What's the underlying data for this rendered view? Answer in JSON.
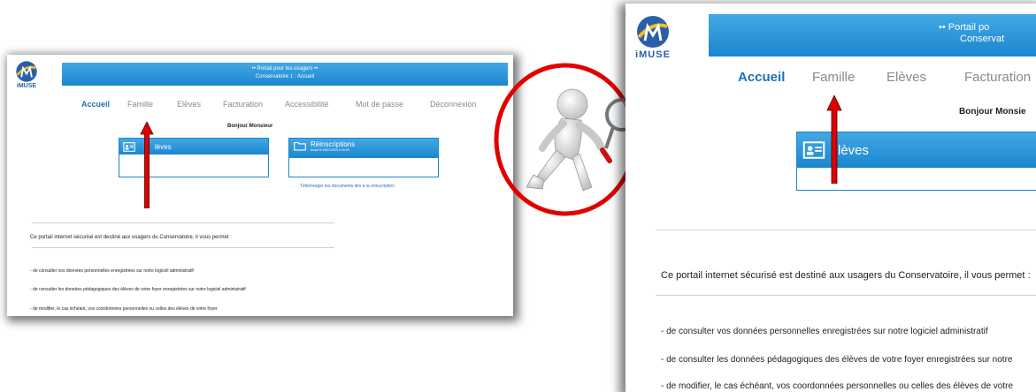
{
  "brand": {
    "logo_text": "iMUSE"
  },
  "banner": {
    "title": "•• Portail pour les usagers ••",
    "subtitle": "Conservatoire 1 : Accueil"
  },
  "banner_right": {
    "title": "•• Portail po",
    "subtitle": "Conservat"
  },
  "nav": {
    "items": [
      "Accueil",
      "Famille",
      "Elèves",
      "Facturation",
      "Accessibilité",
      "Mot de passe",
      "Déconnexion"
    ]
  },
  "greeting": "Bonjour Monsieur",
  "greeting_right": "Bonjour Monsie",
  "cards": {
    "eleves": {
      "label": "Elèves",
      "label_right": "lèves",
      "label_left": "lèves"
    },
    "reinscriptions": {
      "label": "Réinscriptions",
      "sub": "Avant le 18/07/2023 à 00:00"
    }
  },
  "docs_link": "Télécharger les documents liés à la réinscription",
  "intro_text": "Ce portail internet sécurisé est destiné aux usagers du Conservatoire, il vous permet :",
  "bullets": [
    "- de consulter vos données personnelles enregistrées sur notre logiciel administratif",
    "- de consulter les données pédagogiques des élèves de votre foyer enregistrées sur notre logiciel administratif",
    "- de modifier, le cas échéant, vos coordonnées personnelles ou celles des élèves de votre foyer"
  ],
  "bullets_right": [
    "- de consulter vos données personnelles enregistrées sur notre logiciel administratif",
    "- de consulter les données pédagogiques des élèves de votre foyer enregistrées sur notre",
    "- de modifier, le cas échéant, vos coordonnées personnelles ou celles des élèves de votre"
  ],
  "colors": {
    "accent": "#1b86cf",
    "nav_active": "#1f70b8",
    "arrow": "#e00000",
    "circle": "#e00000"
  },
  "icons": [
    "imuse-logo-icon",
    "id-card-icon",
    "folder-icon",
    "magnifier-figure-icon",
    "red-arrow-icon"
  ]
}
